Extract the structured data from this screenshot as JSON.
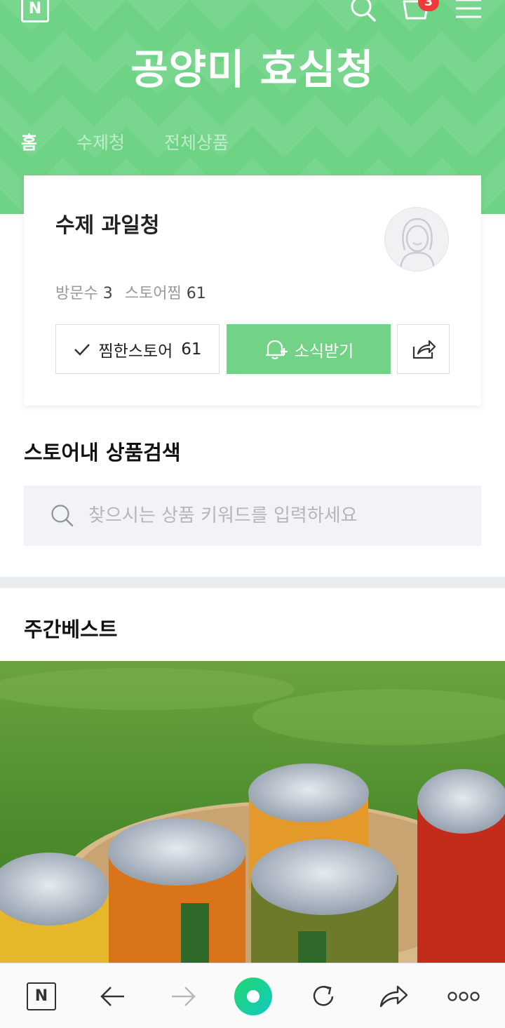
{
  "header": {
    "logo_letter": "N",
    "cart_count": "3",
    "store_name": "공양미 효심청",
    "tabs": [
      {
        "label": "홈",
        "active": true
      },
      {
        "label": "수제청",
        "active": false
      },
      {
        "label": "전체상품",
        "active": false
      }
    ]
  },
  "profile": {
    "name": "수제 과일청",
    "visits_label": "방문수",
    "visits": "3",
    "store_fav_label": "스토어찜",
    "store_fav": "61",
    "fav_button_label": "찜한스토어",
    "fav_button_count": "61",
    "news_button_label": "소식받기"
  },
  "search": {
    "title": "스토어내 상품검색",
    "placeholder": "찾으시는 상품 키워드를 입력하세요"
  },
  "weekly_best": {
    "title": "주간베스트"
  },
  "bottom_bar": {
    "logo_letter": "N"
  },
  "colors": {
    "brand_green": "#6fd386",
    "badge_red": "#f03a3a",
    "search_bg": "#f2f3f6"
  }
}
